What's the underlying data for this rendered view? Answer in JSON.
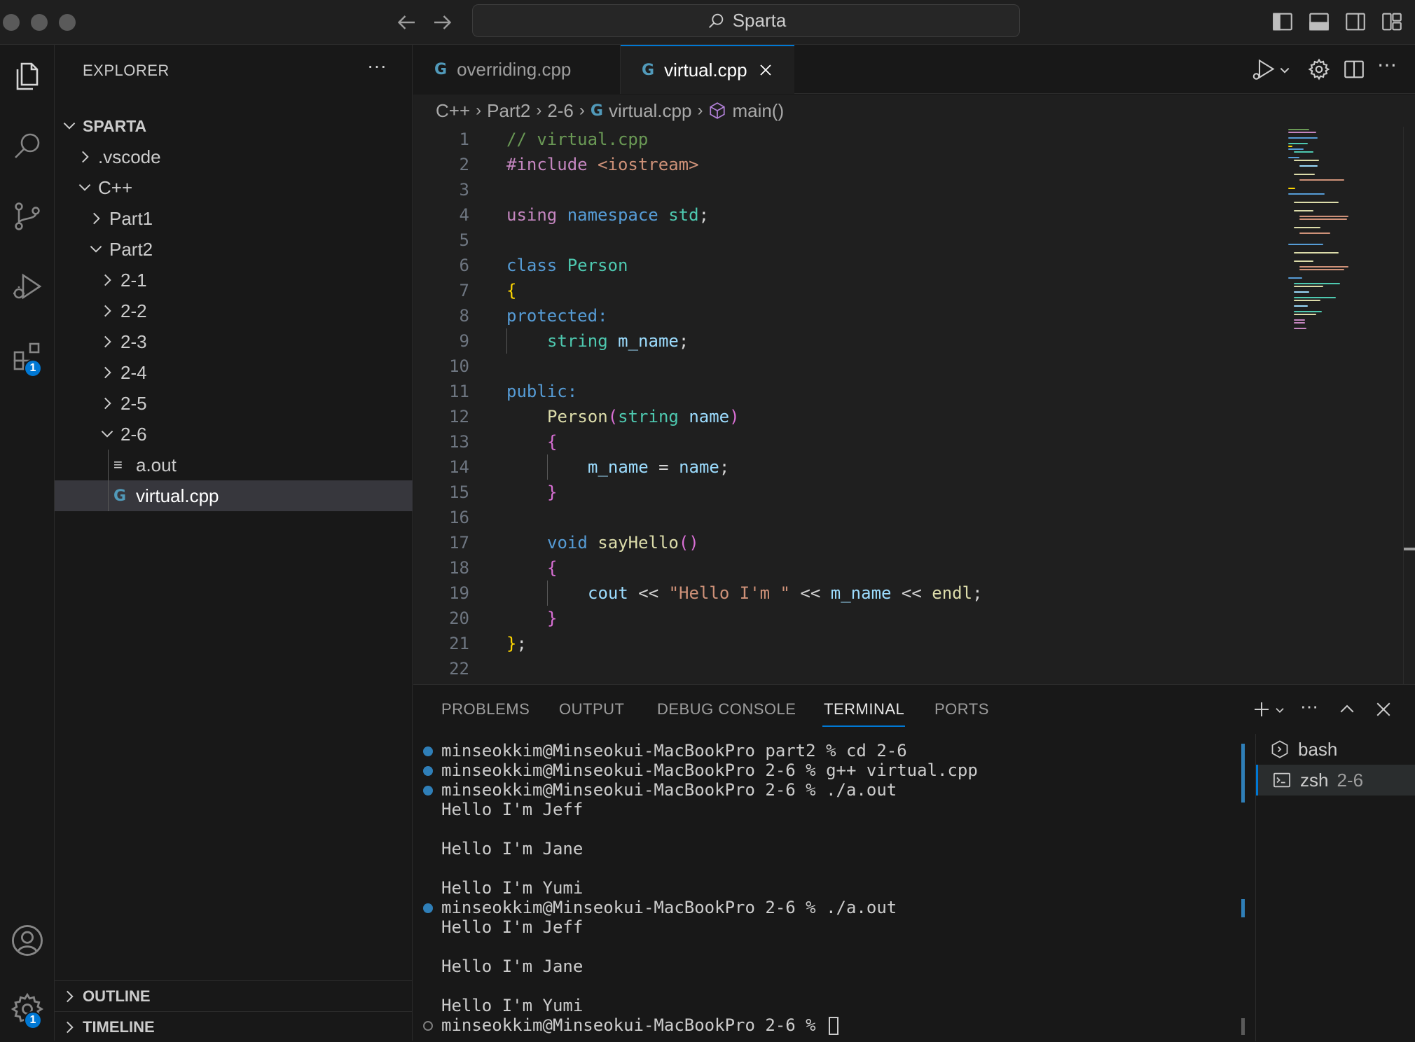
{
  "titlebar": {
    "search_text": "Sparta"
  },
  "activity_bar": {
    "extensions_badge": "1",
    "settings_badge": "1"
  },
  "explorer": {
    "title": "EXPLORER",
    "more": "···",
    "root": "SPARTA",
    "items": {
      "vscode": ".vscode",
      "cpp": "C++",
      "part1": "Part1",
      "part2": "Part2",
      "f21": "2-1",
      "f22": "2-2",
      "f23": "2-3",
      "f24": "2-4",
      "f25": "2-5",
      "f26": "2-6",
      "aout": "a.out",
      "virtual": "virtual.cpp"
    },
    "outline": "OUTLINE",
    "timeline": "TIMELINE"
  },
  "tabs": [
    {
      "label": "overriding.cpp",
      "icon": "G"
    },
    {
      "label": "virtual.cpp",
      "icon": "G"
    }
  ],
  "breadcrumb": {
    "c1": "C++",
    "c2": "Part2",
    "c3": "2-6",
    "c4": "virtual.cpp",
    "c5": "main()"
  },
  "editor": {
    "line_numbers": [
      "1",
      "2",
      "3",
      "4",
      "5",
      "6",
      "7",
      "8",
      "9",
      "10",
      "11",
      "12",
      "13",
      "14",
      "15",
      "16",
      "17",
      "18",
      "19",
      "20",
      "21",
      "22"
    ],
    "code": {
      "l1": "// virtual.cpp",
      "l2_kw": "#include",
      "l2_inc": "<iostream>",
      "l4_a": "using",
      "l4_b": "namespace",
      "l4_c": "std",
      "l4_d": ";",
      "l6_a": "class",
      "l6_b": "Person",
      "l7": "{",
      "l8": "protected:",
      "l9_a": "string",
      "l9_b": "m_name",
      "l9_c": ";",
      "l11": "public:",
      "l12_a": "Person",
      "l12_b": "(",
      "l12_c": "string",
      "l12_d": "name",
      "l12_e": ")",
      "l13": "{",
      "l14_a": "m_name",
      "l14_b": " = ",
      "l14_c": "name",
      "l14_d": ";",
      "l15": "}",
      "l17_a": "void",
      "l17_b": "sayHello",
      "l17_c": "()",
      "l18": "{",
      "l19_a": "cout",
      "l19_b": " << ",
      "l19_c": "\"Hello I'm \"",
      "l19_d": " << ",
      "l19_e": "m_name",
      "l19_f": " << ",
      "l19_g": "endl",
      "l19_h": ";",
      "l20": "}",
      "l21_a": "}",
      "l21_b": ";"
    }
  },
  "panel": {
    "tabs": {
      "problems": "PROBLEMS",
      "output": "OUTPUT",
      "debug": "DEBUG CONSOLE",
      "terminal": "TERMINAL",
      "ports": "PORTS"
    },
    "terminal_lines": [
      "minseokkim@Minseokui-MacBookPro part2 % cd 2-6",
      "minseokkim@Minseokui-MacBookPro 2-6 % g++ virtual.cpp",
      "minseokkim@Minseokui-MacBookPro 2-6 % ./a.out",
      "Hello I'm Jeff",
      "",
      "Hello I'm Jane",
      "",
      "Hello I'm Yumi",
      "minseokkim@Minseokui-MacBookPro 2-6 % ./a.out",
      "Hello I'm Jeff",
      "",
      "Hello I'm Jane",
      "",
      "Hello I'm Yumi",
      "minseokkim@Minseokui-MacBookPro 2-6 % "
    ],
    "terminal_list": [
      {
        "name": "bash",
        "sub": ""
      },
      {
        "name": "zsh",
        "sub": "2-6"
      }
    ]
  },
  "colors": {
    "accent": "#0078d4",
    "editor_bg": "#1f1f1f",
    "sidebar_bg": "#181818"
  }
}
